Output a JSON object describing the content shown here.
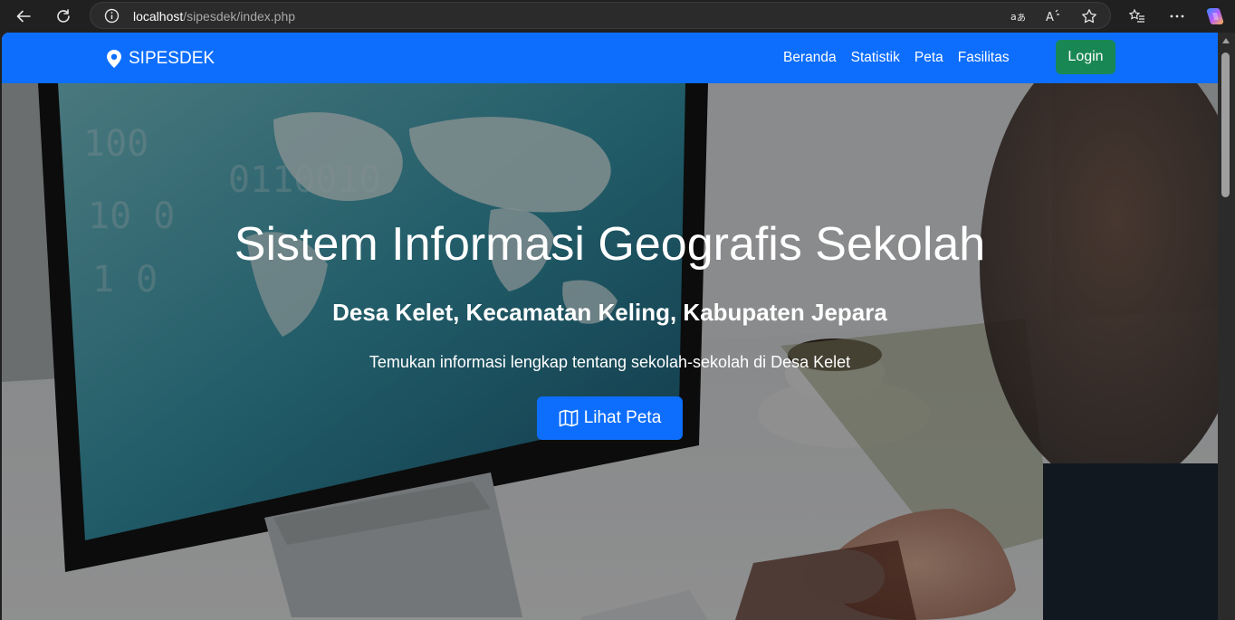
{
  "browser": {
    "url_host": "localhost",
    "url_path": "/sipesdek/index.php"
  },
  "navbar": {
    "brand": "SIPESDEK",
    "menu": [
      "Beranda",
      "Statistik",
      "Peta",
      "Fasilitas"
    ],
    "login": "Login"
  },
  "hero": {
    "title": "Sistem Informasi Geografis Sekolah",
    "subtitle": "Desa Kelet, Kecamatan Keling, Kabupaten Jepara",
    "description": "Temukan informasi lengkap tentang sekolah-sekolah di Desa Kelet",
    "button": "Lihat Peta"
  },
  "colors": {
    "primary": "#0d6efd",
    "success": "#198754"
  }
}
